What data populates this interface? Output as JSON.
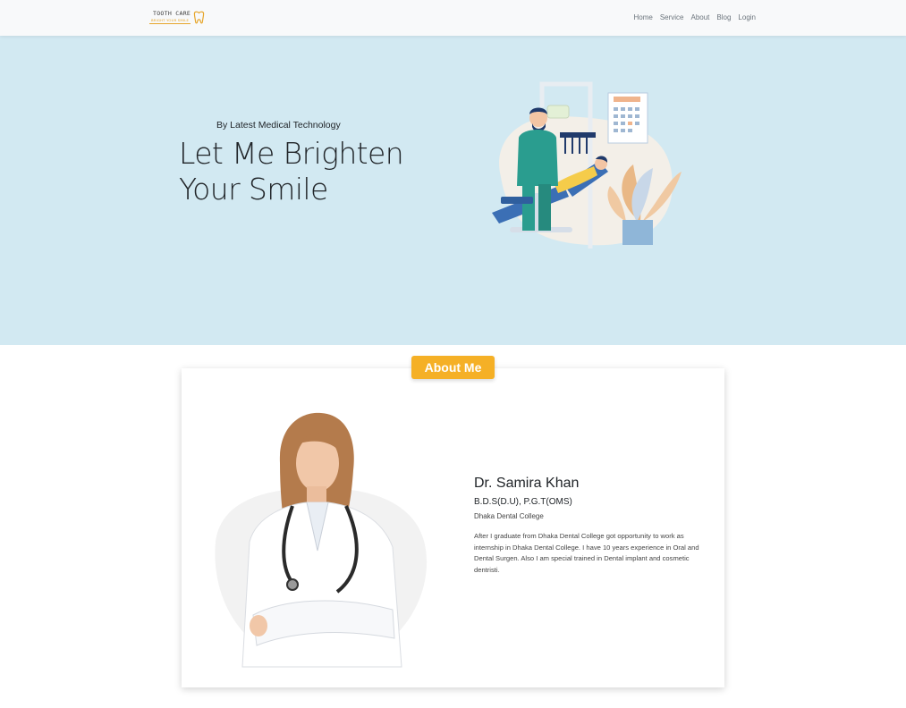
{
  "navbar": {
    "brand": {
      "line1": "TOOTH CARE",
      "line2": "BRIGHT YOUR SMILE"
    },
    "links": [
      "Home",
      "Service",
      "About",
      "Blog",
      "Login"
    ]
  },
  "hero": {
    "subtitle": "By Latest Medical Technology",
    "title_line1": "Let Me Brighten",
    "title_line2": "Your Smile"
  },
  "about": {
    "badge": "About Me",
    "name": "Dr. Samira Khan",
    "degree": "B.D.S(D.U), P.G.T(OMS)",
    "college": "Dhaka Dental College",
    "bio": "After I graduate from Dhaka Dental College got opportunity to work as internship in Dhaka Dental College. I have 10 years experience in Oral and Dental Surgen. Also I am special trained in Dental implant and cosmetic dentristi."
  },
  "colors": {
    "hero_bg": "#d2e9f2",
    "accent": "#f5b026",
    "navbar_bg": "#f8f9fa"
  }
}
